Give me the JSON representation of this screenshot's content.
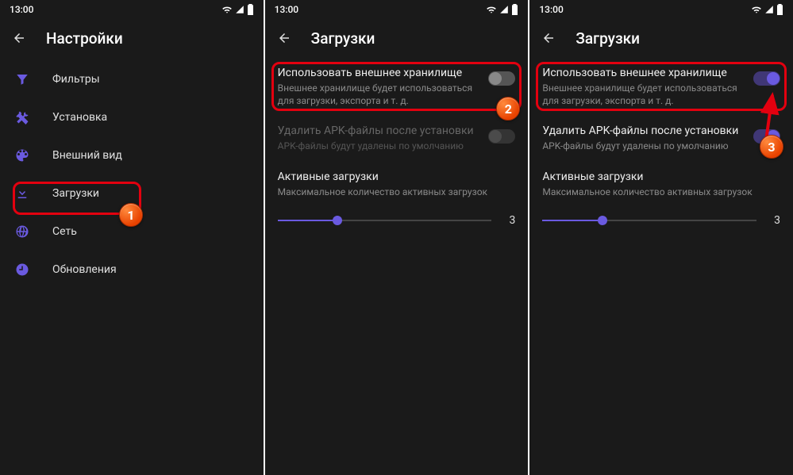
{
  "status": {
    "time": "13:00"
  },
  "screen1": {
    "title": "Настройки",
    "menu": [
      {
        "label": "Фильтры"
      },
      {
        "label": "Установка"
      },
      {
        "label": "Внешний вид"
      },
      {
        "label": "Загрузки"
      },
      {
        "label": "Сеть"
      },
      {
        "label": "Обновления"
      }
    ]
  },
  "screen2": {
    "title": "Загрузки",
    "ext_title": "Использовать внешнее хранилище",
    "ext_sub": "Внешнее хранилище будет использоваться для загрузки, экспорта и т. д.",
    "del_title": "Удалить APK-файлы после установки",
    "del_sub": "APK-файлы будут удалены по умолчанию",
    "active_title": "Активные загрузки",
    "active_sub": "Максимальное количество активных загрузок",
    "slider_val": "3"
  },
  "screen3": {
    "title": "Загрузки",
    "ext_title": "Использовать внешнее хранилище",
    "ext_sub": "Внешнее хранилище будет использоваться для загрузки, экспорта и т. д.",
    "del_title": "Удалить APK-файлы после установки",
    "del_sub": "APK-файлы будут удалены по умолчанию",
    "active_title": "Активные загрузки",
    "active_sub": "Максимальное количество активных загрузок",
    "slider_val": "3"
  },
  "annotations": {
    "b1": "1",
    "b2": "2",
    "b3": "3"
  }
}
